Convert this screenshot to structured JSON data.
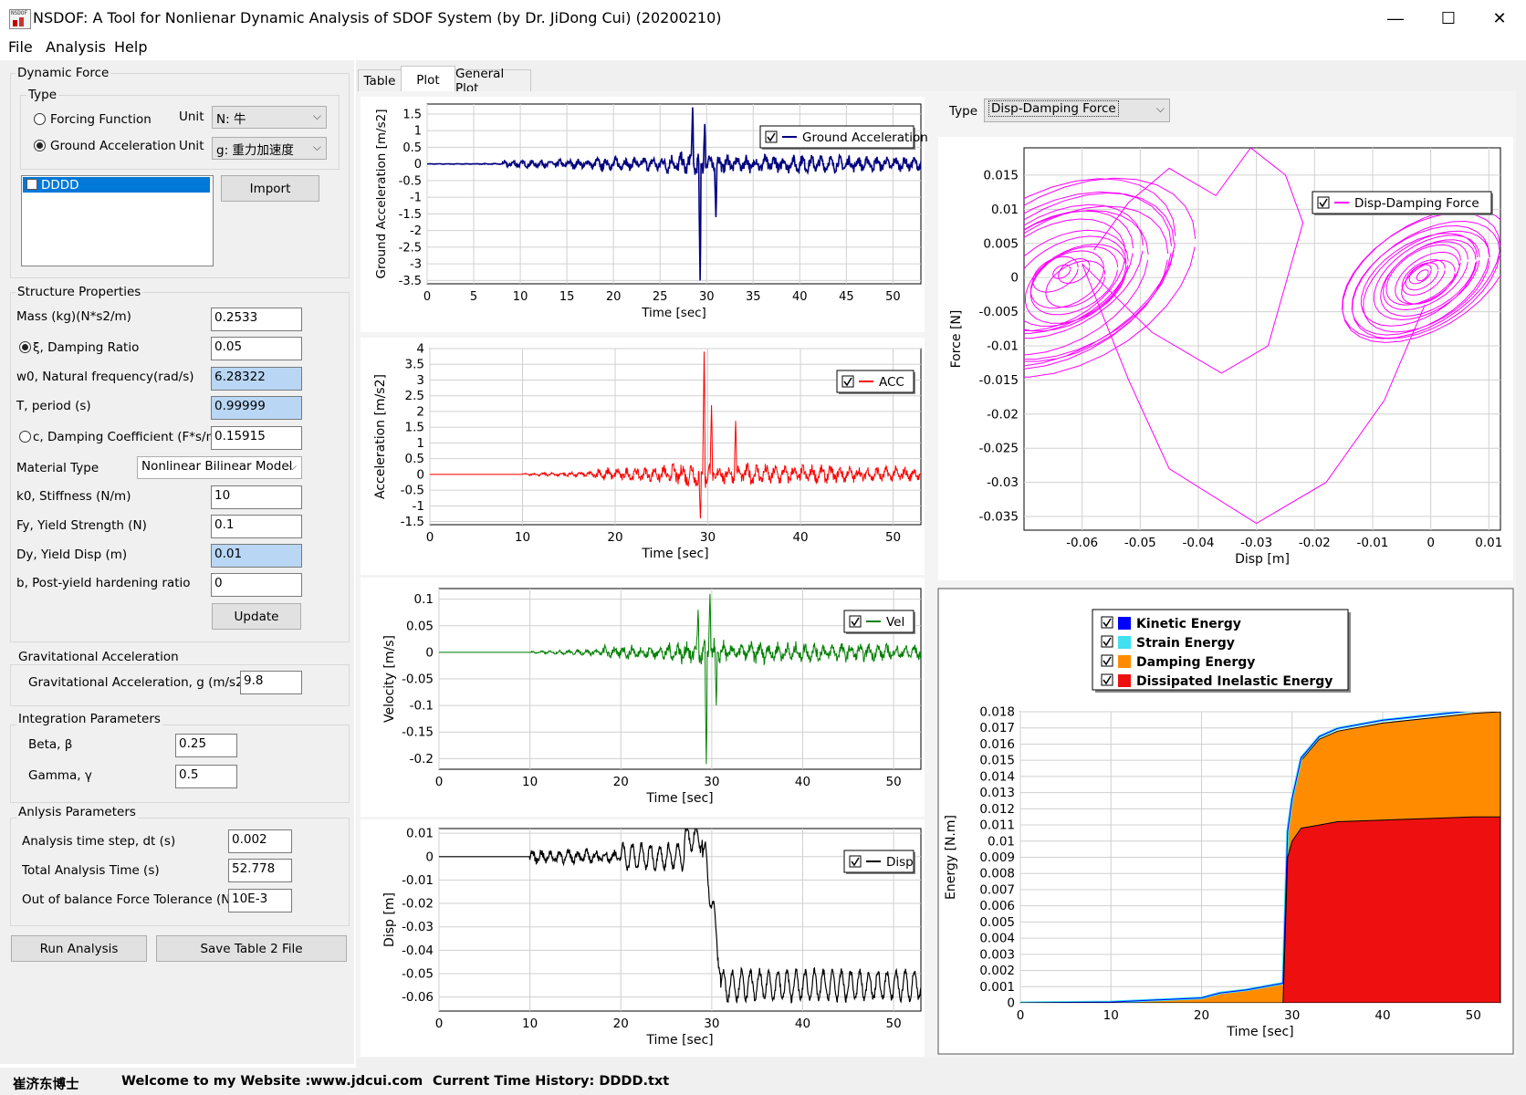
{
  "window": {
    "title": "NSDOF: A Tool for Nonlienar Dynamic Analysis of SDOF System (by Dr. JiDong Cui) (20200210)",
    "minimize": "—",
    "maximize": "☐",
    "close": "✕"
  },
  "menu": {
    "file": "File",
    "analysis": "Analysis",
    "help": "Help"
  },
  "dynamic_force": {
    "group_label": "Dynamic Force",
    "type_label": "Type",
    "forcing_function": "Forcing Function",
    "ground_acceleration": "Ground Acceleration",
    "unit_label": "Unit",
    "unit1": "N: 牛",
    "unit2": "g: 重力加速度",
    "list_item": "DDDD",
    "import": "Import"
  },
  "structure": {
    "group_label": "Structure Properties",
    "mass_label": "Mass (kg)(N*s2/m)",
    "mass": "0.2533",
    "damping_ratio_label": "ξ, Damping Ratio",
    "damping_ratio": "0.05",
    "w0_label": "w0, Natural frequency(rad/s)",
    "w0": "6.28322",
    "period_label": "T, period (s)",
    "period": "0.99999",
    "damping_coef_label": "c, Damping Coefficient (F*s/m)",
    "damping_coef": "0.15915",
    "material_label": "Material Type",
    "material": "Nonlinear Bilinear Model",
    "k0_label": "k0, Stiffness (N/m)",
    "k0": "10",
    "fy_label": "Fy, Yield Strength (N)",
    "fy": "0.1",
    "dy_label": "Dy, Yield Disp (m)",
    "dy": "0.01",
    "b_label": "b, Post-yield hardening ratio",
    "b": "0",
    "update": "Update"
  },
  "gravity": {
    "group_label": "Gravitational Acceleration",
    "g_label": "Gravitational Acceleration, g (m/s2)",
    "g": "9.8"
  },
  "integration": {
    "group_label": "Integration Parameters",
    "beta_label": "Beta, β",
    "beta": "0.25",
    "gamma_label": "Gamma, γ",
    "gamma": "0.5"
  },
  "analysis": {
    "group_label": "Anlysis  Parameters",
    "dt_label": "Analysis time step, dt (s)",
    "dt": "0.002",
    "total_label": "Total Analysis Time (s)",
    "total": "52.778",
    "tol_label": "Out of balance Force Tolerance (N)",
    "tol": "10E-3",
    "run": "Run Analysis",
    "save": "Save Table 2 File"
  },
  "tabs": {
    "table": "Table",
    "plot": "Plot",
    "general": "General Plot"
  },
  "type_select": {
    "label": "Type",
    "value": "Disp-Damping Force"
  },
  "status": {
    "author": "崔济东博士",
    "welcome": "Welcome to my Website :",
    "site": "www.jdcui.com",
    "history": "Current Time History: DDDD.txt"
  },
  "colors": {
    "ground": "#000080",
    "acc": "#ff0000",
    "vel": "#008000",
    "disp": "#000000",
    "hyst": "#ff00ff",
    "kinetic": "#0000ff",
    "strain": "#40e0f0",
    "damping": "#ff8c00",
    "dissipated": "#ee1010"
  },
  "chart_data": [
    {
      "type": "line",
      "series": [
        {
          "name": "Ground Acceleration"
        }
      ],
      "xlabel": "Time [sec]",
      "ylabel": "Ground Acceleration [m/s2]",
      "xlim": [
        0,
        53
      ],
      "ylim": [
        -3.6,
        1.8
      ],
      "xticks": [
        0,
        5,
        10,
        15,
        20,
        25,
        30,
        35,
        40,
        45,
        50
      ],
      "yticks": [
        1.5,
        1,
        0.5,
        0,
        -0.5,
        -1,
        -1.5,
        -2,
        -2.5,
        -3,
        -3.5
      ],
      "legend": "top-right",
      "grid": true,
      "amp": 0.35,
      "spikes": [
        [
          29.3,
          -3.5
        ],
        [
          28.5,
          1.7
        ],
        [
          29.8,
          1.2
        ],
        [
          31,
          -1.6
        ]
      ],
      "start": 0
    },
    {
      "type": "line",
      "series": [
        {
          "name": "ACC"
        }
      ],
      "xlabel": "Time [sec]",
      "ylabel": "Acceleration [m/s2]",
      "xlim": [
        0,
        53
      ],
      "ylim": [
        -1.6,
        4
      ],
      "xticks": [
        0,
        10,
        20,
        30,
        40,
        50
      ],
      "yticks": [
        4,
        3.5,
        3,
        2.5,
        2,
        1.5,
        1,
        0.5,
        0,
        -0.5,
        -1,
        -1.5
      ],
      "legend": "top-right",
      "grid": true,
      "amp": 0.4,
      "spikes": [
        [
          29.6,
          3.9
        ],
        [
          30.4,
          2.2
        ],
        [
          29.2,
          -1.4
        ],
        [
          33,
          1.7
        ]
      ],
      "start": 10
    },
    {
      "type": "line",
      "series": [
        {
          "name": "Vel"
        }
      ],
      "xlabel": "Time [sec]",
      "ylabel": "Velocity [m/s]",
      "xlim": [
        0,
        53
      ],
      "ylim": [
        -0.22,
        0.12
      ],
      "xticks": [
        0,
        10,
        20,
        30,
        40,
        50
      ],
      "yticks": [
        0.1,
        0.05,
        0,
        -0.05,
        -0.1,
        -0.15,
        -0.2
      ],
      "legend": "top-right",
      "grid": true,
      "amp": 0.025,
      "spikes": [
        [
          29.4,
          -0.21
        ],
        [
          29.8,
          0.11
        ],
        [
          28.5,
          0.08
        ],
        [
          30.5,
          -0.1
        ]
      ],
      "start": 10
    },
    {
      "type": "line",
      "series": [
        {
          "name": "Disp"
        }
      ],
      "xlabel": "Time [sec]",
      "ylabel": "Disp [m]",
      "xlim": [
        0,
        53
      ],
      "ylim": [
        -0.066,
        0.012
      ],
      "xticks": [
        0,
        10,
        20,
        30,
        40,
        50
      ],
      "yticks": [
        0.01,
        0,
        -0.01,
        -0.02,
        -0.03,
        -0.04,
        -0.05,
        -0.06
      ],
      "legend": "top-right",
      "grid": true
    },
    {
      "type": "line",
      "series": [
        {
          "name": "Disp-Damping Force"
        }
      ],
      "xlabel": "Disp [m]",
      "ylabel": "Force [N]",
      "xlim": [
        -0.07,
        0.012
      ],
      "ylim": [
        -0.037,
        0.019
      ],
      "xticks": [
        -0.06,
        -0.05,
        -0.04,
        -0.03,
        -0.02,
        -0.01,
        0,
        0.01
      ],
      "yticks": [
        0.015,
        0.01,
        0.005,
        0,
        -0.005,
        -0.01,
        -0.015,
        -0.02,
        -0.025,
        -0.03,
        -0.035
      ],
      "legend": "top-right",
      "grid": true
    },
    {
      "type": "area",
      "series": [
        {
          "name": "Kinetic Energy"
        },
        {
          "name": "Strain Energy"
        },
        {
          "name": "Damping Energy"
        },
        {
          "name": "Dissipated Inelastic Energy"
        }
      ],
      "x": [
        0,
        10,
        20,
        22,
        25,
        29,
        29.5,
        30,
        31,
        33,
        35,
        40,
        45,
        50,
        53
      ],
      "damping_top": [
        0,
        5e-05,
        0.0003,
        0.0006,
        0.0008,
        0.0012,
        0.0105,
        0.0125,
        0.015,
        0.0163,
        0.0168,
        0.0173,
        0.0176,
        0.0179,
        0.018
      ],
      "dissipated_top": [
        0,
        0,
        0,
        0,
        0,
        0,
        0.009,
        0.01,
        0.0108,
        0.011,
        0.0112,
        0.0113,
        0.0114,
        0.0115,
        0.0115
      ],
      "xlabel": "Time [sec]",
      "ylabel": "Energy [N.m]",
      "xlim": [
        0,
        53
      ],
      "ylim": [
        0,
        0.018
      ],
      "xticks": [
        0,
        10,
        20,
        30,
        40,
        50
      ],
      "yticks": [
        0.018,
        0.017,
        0.016,
        0.015,
        0.014,
        0.013,
        0.012,
        0.011,
        0.01,
        0.009,
        0.008,
        0.007,
        0.006,
        0.005,
        0.004,
        0.003,
        0.002,
        0.001,
        0
      ],
      "legend": "top-center",
      "grid": true
    }
  ]
}
